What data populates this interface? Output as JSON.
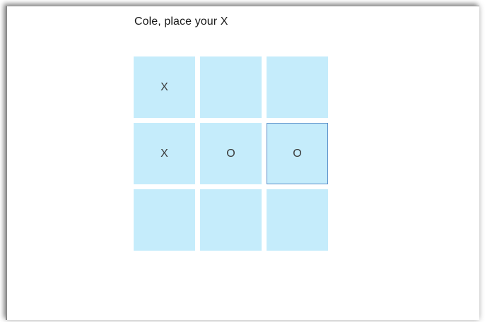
{
  "status": {
    "prompt": "Cole, place your X"
  },
  "board": {
    "cells": [
      {
        "row": 1,
        "col": 1,
        "mark": "X"
      },
      {
        "row": 1,
        "col": 2,
        "mark": ""
      },
      {
        "row": 1,
        "col": 3,
        "mark": ""
      },
      {
        "row": 2,
        "col": 1,
        "mark": "X"
      },
      {
        "row": 2,
        "col": 2,
        "mark": "O"
      },
      {
        "row": 2,
        "col": 3,
        "mark": "O"
      },
      {
        "row": 3,
        "col": 1,
        "mark": ""
      },
      {
        "row": 3,
        "col": 2,
        "mark": ""
      },
      {
        "row": 3,
        "col": 3,
        "mark": ""
      }
    ],
    "focused_cell": {
      "row": 2,
      "col": 3
    },
    "cell_color": "#c5ecfb",
    "focus_border_color": "#5a8fc8"
  }
}
